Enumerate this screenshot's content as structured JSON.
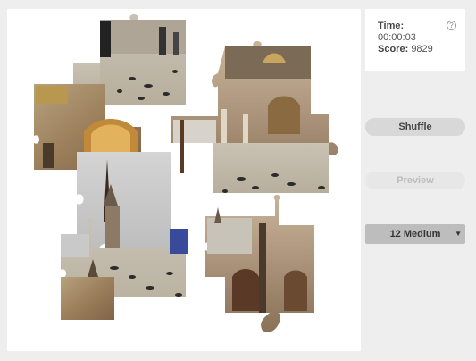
{
  "status": {
    "time_label": "Time:",
    "time_value": "00:00:03",
    "score_label": "Score:",
    "score_value": "9829"
  },
  "controls": {
    "shuffle_label": "Shuffle",
    "preview_label": "Preview",
    "size_value": "12 Medium"
  },
  "icons": {
    "help": "help-icon",
    "dropdown": "chevron-down-icon"
  },
  "colors": {
    "background": "#eeeeee",
    "board": "#ffffff",
    "button": "#d8d8d8"
  }
}
